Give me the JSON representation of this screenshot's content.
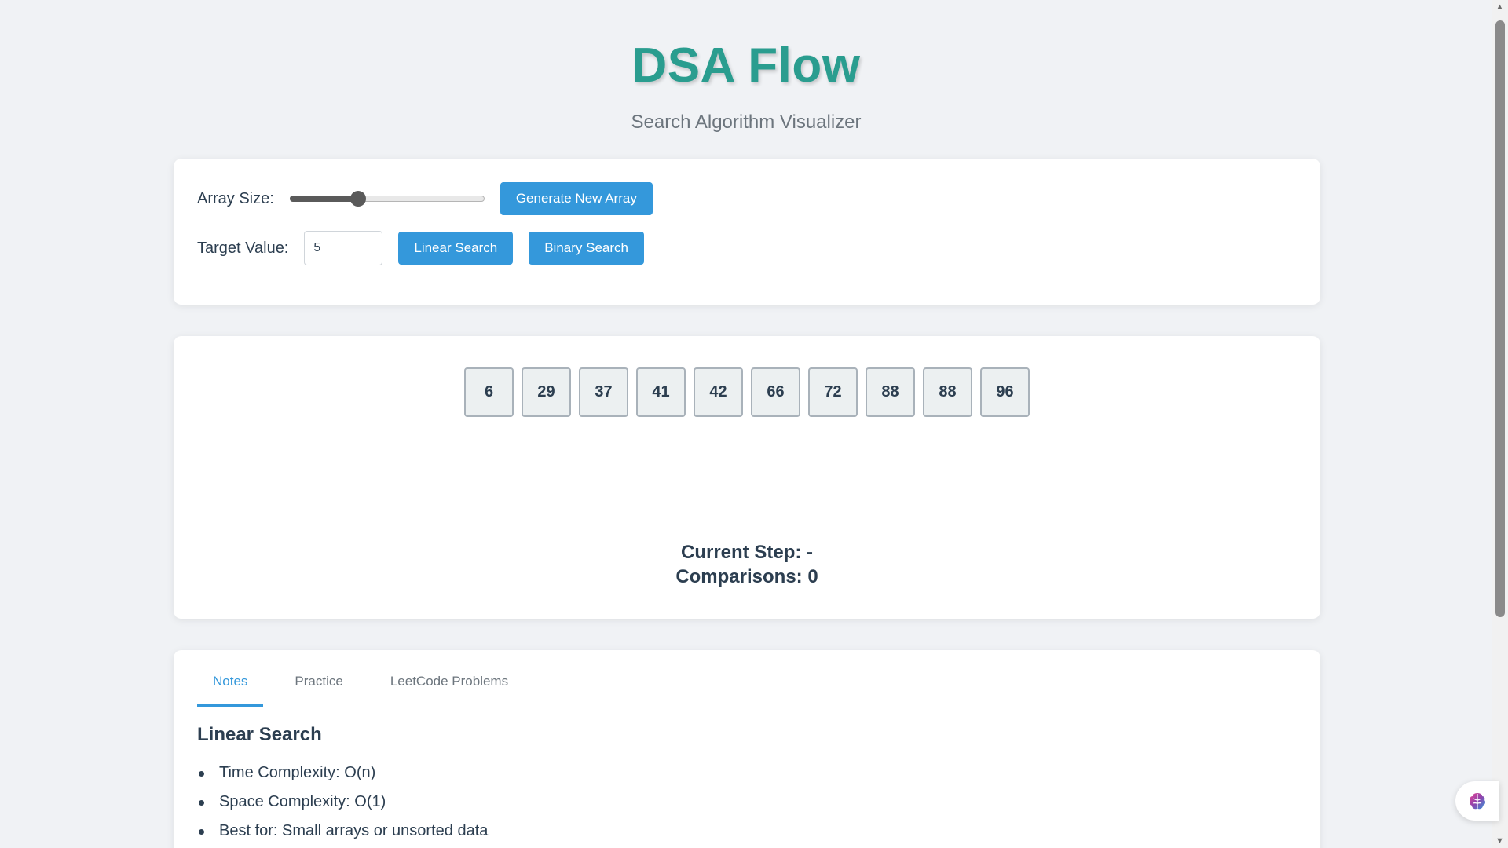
{
  "header": {
    "title": "DSA Flow",
    "subtitle": "Search Algorithm Visualizer"
  },
  "controls": {
    "array_size_label": "Array Size:",
    "array_size_slider_level": 0.35,
    "generate_button": "Generate New Array",
    "target_label": "Target Value:",
    "target_value": "5",
    "linear_search_button": "Linear Search",
    "binary_search_button": "Binary Search"
  },
  "array": {
    "values": [
      "6",
      "29",
      "37",
      "41",
      "42",
      "66",
      "72",
      "88",
      "88",
      "96"
    ]
  },
  "stats": {
    "current_step": "Current Step: -",
    "comparisons": "Comparisons: 0"
  },
  "tabs": [
    {
      "label": "Notes",
      "active": true
    },
    {
      "label": "Practice",
      "active": false
    },
    {
      "label": "LeetCode Problems",
      "active": false
    }
  ],
  "notes": {
    "title": "Linear Search",
    "items": [
      "Time Complexity: O(n)",
      "Space Complexity: O(1)",
      "Best for: Small arrays or unsorted data"
    ]
  },
  "colors": {
    "brand": "#2a9d8f",
    "accent": "#3498db",
    "background": "#f0f2f5"
  },
  "icons": {
    "floating_widget": "brain-icon"
  }
}
